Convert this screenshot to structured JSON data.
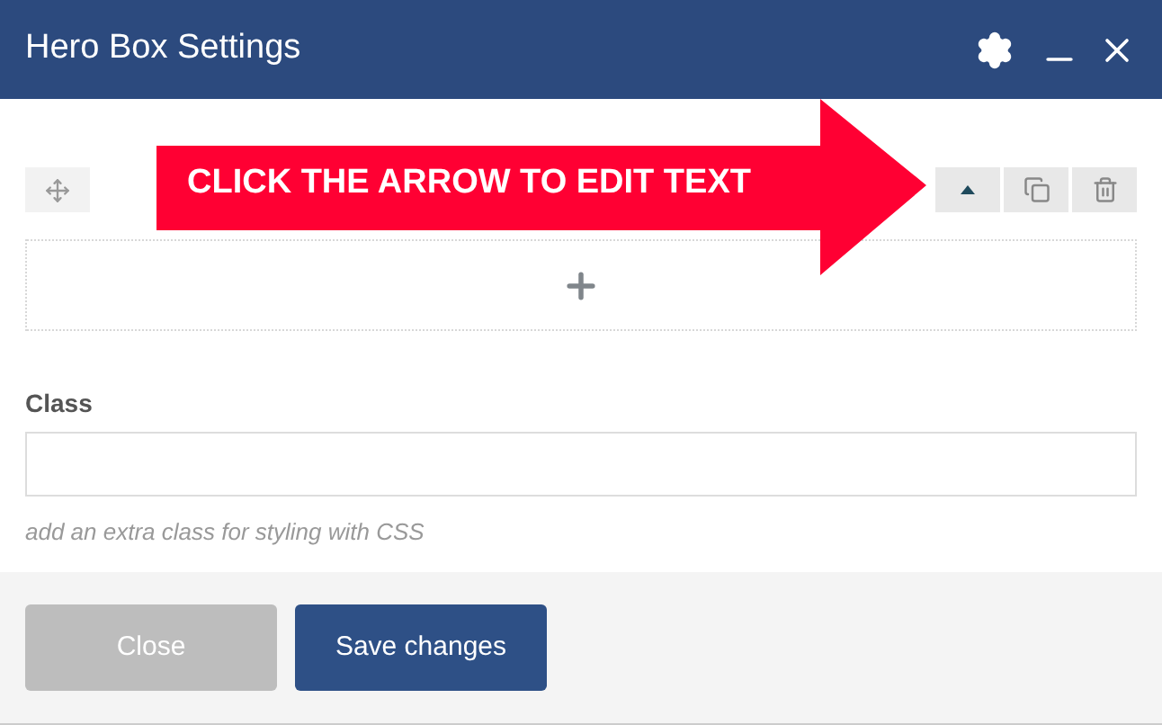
{
  "window": {
    "title": "Hero Box Settings"
  },
  "callout": {
    "text": "CLICK THE ARROW TO EDIT TEXT"
  },
  "field": {
    "label": "Class",
    "help": "add an extra class for styling with CSS"
  },
  "buttons": [
    {
      "label": "Close",
      "kind": "secondary"
    },
    {
      "label": "Save changes",
      "kind": "primary"
    }
  ]
}
